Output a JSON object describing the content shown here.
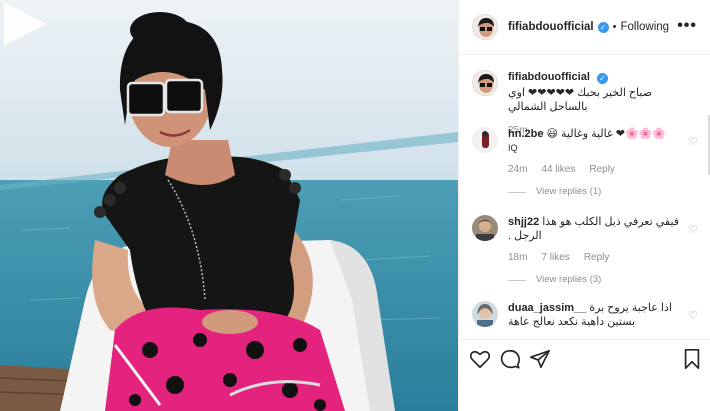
{
  "header": {
    "username": "fifiabdouofficial",
    "separator": "•",
    "follow_state": "Following",
    "more_label": "•••"
  },
  "caption": {
    "username": "fifiabdouofficial",
    "text": "صباح الخير بحبك ❤❤❤❤❤ اوي بالساحل الشمالي",
    "time": "25m"
  },
  "comments": [
    {
      "username": "hn.2be",
      "text": "🌸🌸🌸❤ غالية وغالية 😃",
      "extra": "IQ",
      "time": "24m",
      "likes": "44 likes",
      "reply": "Reply",
      "view_replies": "View replies (1)"
    },
    {
      "username": "shjj22",
      "text": "فيفي تعرفي ذيل الكلب هو هذا الرجل .",
      "time": "18m",
      "likes": "7 likes",
      "reply": "Reply",
      "view_replies": "View replies (3)"
    },
    {
      "username": "duaa_jassim__",
      "text": "اذا عاجبة يروح برة بستين داهية نكعد نعالج عاهة",
      "time": "",
      "likes": "",
      "reply": "",
      "view_replies": ""
    }
  ],
  "colors": {
    "verified": "#3897f0",
    "text": "#262626",
    "muted": "#8e8e8e",
    "heart": "#ed4956"
  },
  "icons": {
    "play": "play-icon",
    "like": "heart-icon",
    "comment": "comment-icon",
    "share": "share-icon",
    "save": "bookmark-icon",
    "verified": "verified-badge-icon",
    "more": "more-icon"
  }
}
